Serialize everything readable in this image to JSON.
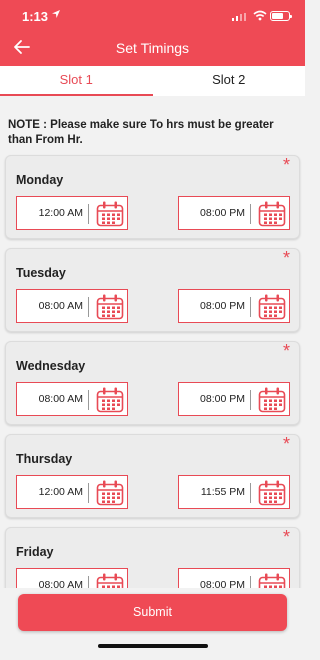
{
  "status_bar": {
    "time": "1:13"
  },
  "header": {
    "title": "Set Timings"
  },
  "tabs": [
    {
      "label": "Slot 1",
      "active": true
    },
    {
      "label": "Slot 2",
      "active": false
    }
  ],
  "note": "NOTE : Please make sure To hrs must be greater than From Hr.",
  "required_mark": "*",
  "days": [
    {
      "name": "Monday",
      "from": "12:00 AM",
      "to": "08:00 PM"
    },
    {
      "name": "Tuesday",
      "from": "08:00 AM",
      "to": "08:00 PM"
    },
    {
      "name": "Wednesday",
      "from": "08:00 AM",
      "to": "08:00 PM"
    },
    {
      "name": "Thursday",
      "from": "12:00 AM",
      "to": "11:55 PM"
    },
    {
      "name": "Friday",
      "from": "08:00 AM",
      "to": "08:00 PM"
    }
  ],
  "submit_label": "Submit",
  "colors": {
    "accent": "#ef4a55",
    "background": "#f2f2f2"
  },
  "icons": [
    "location-arrow-icon",
    "signal-icon",
    "wifi-icon",
    "battery-icon",
    "back-arrow-icon",
    "calendar-icon"
  ]
}
